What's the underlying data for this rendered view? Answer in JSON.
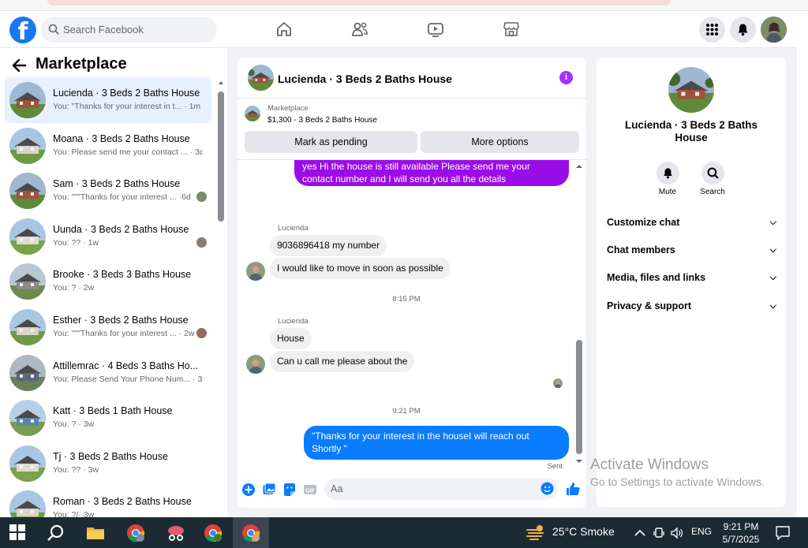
{
  "topbar": {
    "logo_letter": "f",
    "search_placeholder": "Search Facebook"
  },
  "sidebar": {
    "title": "Marketplace",
    "conversations": [
      {
        "name": "Lucienda · 3 Beds 2 Baths House",
        "preview": "You: \"Thanks for your interest in t... · 1m",
        "active": true
      },
      {
        "name": "Moana · 3 Beds 2 Baths House",
        "preview": "You: Please send me your contact ... · 3d"
      },
      {
        "name": "Sam · 3 Beds 2 Baths House",
        "preview": "You: \"\"\"Thanks for your interest ... ·6d"
      },
      {
        "name": "Uunda · 3 Beds 2 Baths House",
        "preview": "You: ?? · 1w"
      },
      {
        "name": "Brooke · 3 Beds 3 Baths House",
        "preview": "You: ? · 2w"
      },
      {
        "name": "Esther · 3 Beds 2 Baths House",
        "preview": "You: \"\"\"Thanks for your interest ... · 2w"
      },
      {
        "name": "Attillemrac · 4 Beds 3 Baths Ho...",
        "preview": "You: Please Send Your Phone Num... · 3w"
      },
      {
        "name": "Katt · 3 Beds 1 Bath House",
        "preview": "You: ? · 3w"
      },
      {
        "name": "Tj · 3 Beds 2 Baths House",
        "preview": "You: ?? · 3w"
      },
      {
        "name": "Roman · 3 Beds 2 Baths House",
        "preview": "You: ?/· 3w"
      }
    ]
  },
  "chat": {
    "title": "Lucienda · 3 Beds 2 Baths House",
    "info_glyph": "i",
    "listing": {
      "label": "Marketplace",
      "price_line": "$1,300 - 3 Beds 2 Baths House",
      "pending_button": "Mark as pending",
      "options_button": "More options"
    },
    "messages": {
      "top_outgoing": "yes Hi the house is still available Please send me your contact number and I will send you all the details",
      "sender1": "Lucienda",
      "in1": "9036896418 my number",
      "in2": "I would like to move in soon as possible",
      "time1": "8:15 PM",
      "sender2": "Lucienda",
      "in3": "House",
      "in4": "Can u call me please about the",
      "time2": "9:21 PM",
      "out_last": "\"Thanks for your interest in the houseI will reach out Shortly \"",
      "sent_status": "Sent"
    },
    "composer_placeholder": "Aa"
  },
  "panel": {
    "name": "Lucienda · 3 Beds 2 Baths House",
    "mute_label": "Mute",
    "search_label": "Search",
    "rows": [
      "Customize chat",
      "Chat members",
      "Media, files and links",
      "Privacy & support"
    ]
  },
  "watermark": {
    "line1": "Activate Windows",
    "line2": "Go to Settings to activate Windows."
  },
  "taskbar": {
    "weather": "25°C  Smoke",
    "lang": "ENG",
    "time": "9:21 PM",
    "date": "5/7/2025"
  },
  "colors": {
    "brand": "#1877f2",
    "outgoing_bubble": "#0a7cff",
    "purple_bubble": "#9b0de8",
    "active_conversation": "#e7f0fd"
  }
}
